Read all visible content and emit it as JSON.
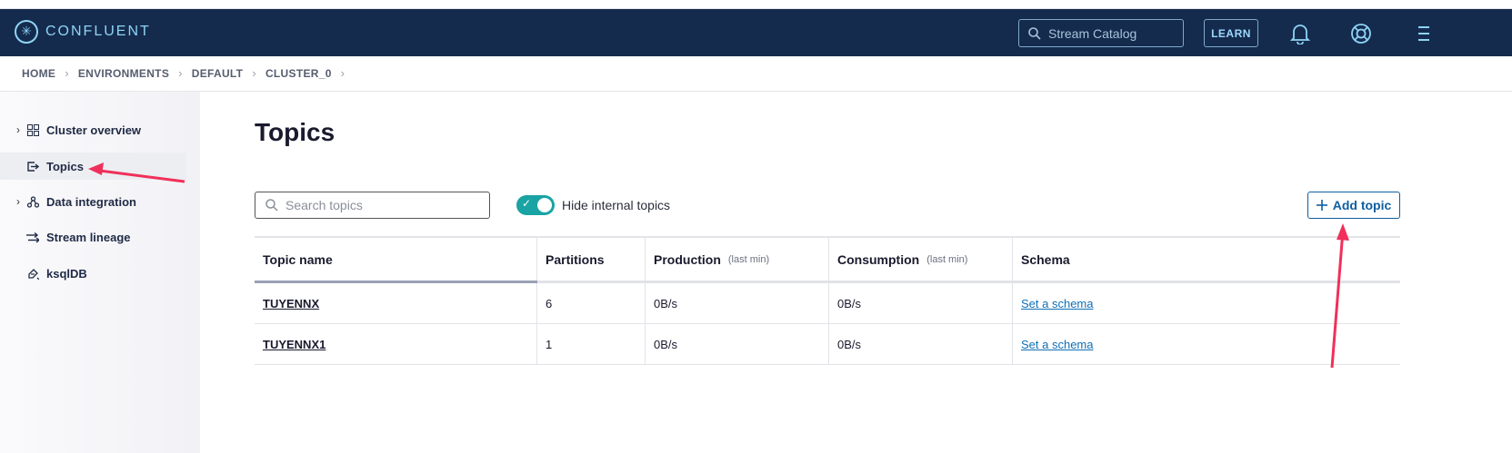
{
  "header": {
    "logo_text": "CONFLUENT",
    "search_placeholder": "Stream Catalog",
    "learn_label": "LEARN",
    "icons": [
      "bell-icon",
      "help-lifebuoy-icon",
      "menu-icon"
    ]
  },
  "breadcrumb": [
    "HOME",
    "ENVIRONMENTS",
    "DEFAULT",
    "CLUSTER_0"
  ],
  "sidebar": {
    "items": [
      {
        "label": "Cluster overview",
        "icon": "grid-icon",
        "expandable": true,
        "active": false
      },
      {
        "label": "Topics",
        "icon": "topic-icon",
        "expandable": false,
        "active": true
      },
      {
        "label": "Data integration",
        "icon": "integration-icon",
        "expandable": true,
        "active": false
      },
      {
        "label": "Stream lineage",
        "icon": "lineage-icon",
        "expandable": false,
        "active": false
      },
      {
        "label": "ksqlDB",
        "icon": "ksqldb-icon",
        "expandable": false,
        "active": false
      }
    ]
  },
  "main": {
    "title": "Topics",
    "search_placeholder": "Search topics",
    "toggle_label": "Hide internal topics",
    "toggle_on": true,
    "add_button_label": "Add topic"
  },
  "table": {
    "columns": [
      {
        "label": "Topic name",
        "sub": ""
      },
      {
        "label": "Partitions",
        "sub": ""
      },
      {
        "label": "Production",
        "sub": "(last min)"
      },
      {
        "label": "Consumption",
        "sub": "(last min)"
      },
      {
        "label": "Schema",
        "sub": ""
      }
    ],
    "rows": [
      {
        "name": "TUYENNX",
        "partitions": "6",
        "production": "0B/s",
        "consumption": "0B/s",
        "schema": "Set a schema"
      },
      {
        "name": "TUYENNX1",
        "partitions": "1",
        "production": "0B/s",
        "consumption": "0B/s",
        "schema": "Set a schema"
      }
    ]
  },
  "colors": {
    "nav_bg": "#142b4d",
    "accent": "#0f5fa0",
    "toggle": "#1aa3a3",
    "annotation_arrow": "#f0305a"
  }
}
